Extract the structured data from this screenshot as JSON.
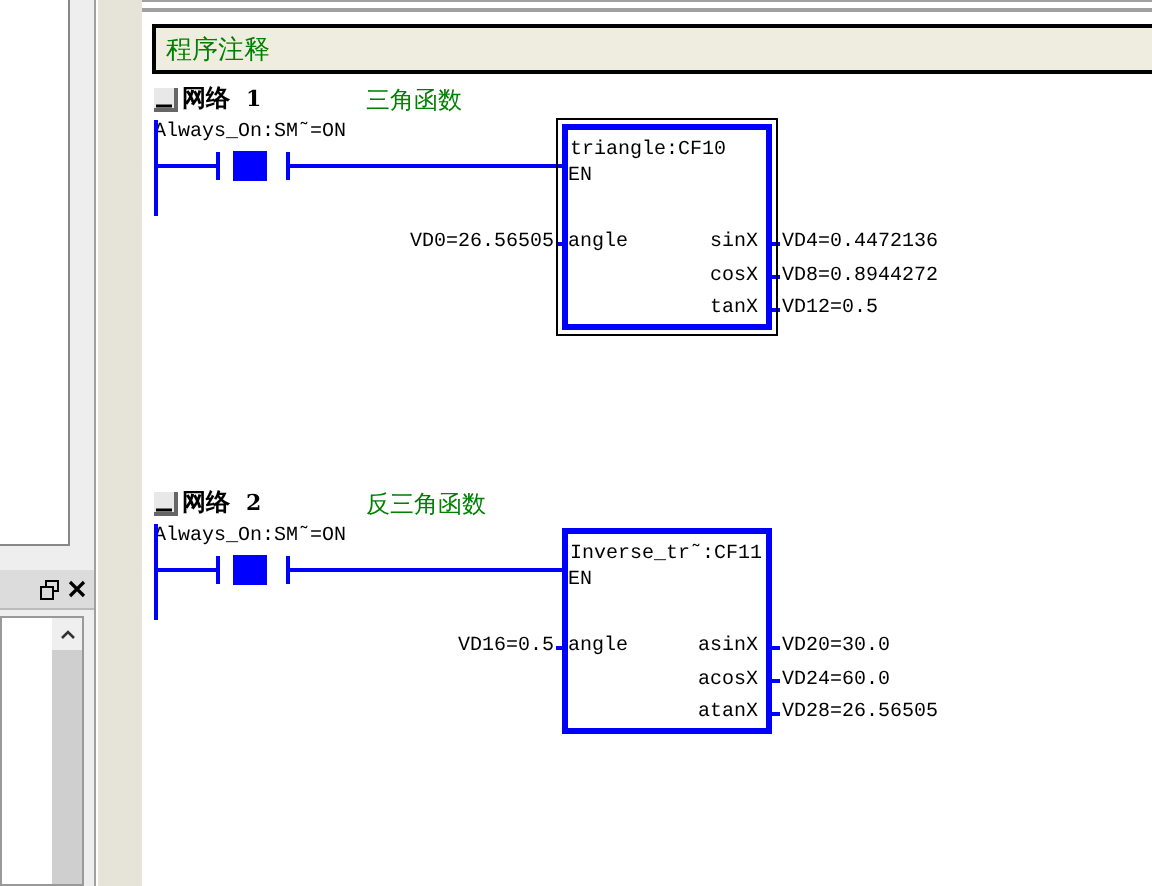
{
  "program_comment": "程序注释",
  "networks": [
    {
      "title": "网络",
      "number": "1",
      "comment": "三角函数",
      "expanded": true,
      "contact": {
        "label": "Always_On:SM˜=ON",
        "energized": true
      },
      "block": {
        "title": "triangle:CF10",
        "en": "EN",
        "selected": true,
        "inputs": [
          {
            "pin": "angle",
            "value": "VD0=26.56505"
          }
        ],
        "outputs": [
          {
            "pin": "sinX",
            "value": "VD4=0.4472136"
          },
          {
            "pin": "cosX",
            "value": "VD8=0.8944272"
          },
          {
            "pin": "tanX",
            "value": "VD12=0.5"
          }
        ]
      }
    },
    {
      "title": "网络",
      "number": "2",
      "comment": "反三角函数",
      "expanded": true,
      "contact": {
        "label": "Always_On:SM˜=ON",
        "energized": true
      },
      "block": {
        "title": "Inverse_tr˜:CF11",
        "en": "EN",
        "selected": false,
        "inputs": [
          {
            "pin": "angle",
            "value": "VD16=0.5"
          }
        ],
        "outputs": [
          {
            "pin": "asinX",
            "value": "VD20=30.0"
          },
          {
            "pin": "acosX",
            "value": "VD24=60.0"
          },
          {
            "pin": "atanX",
            "value": "VD28=26.56505"
          }
        ]
      }
    }
  ]
}
